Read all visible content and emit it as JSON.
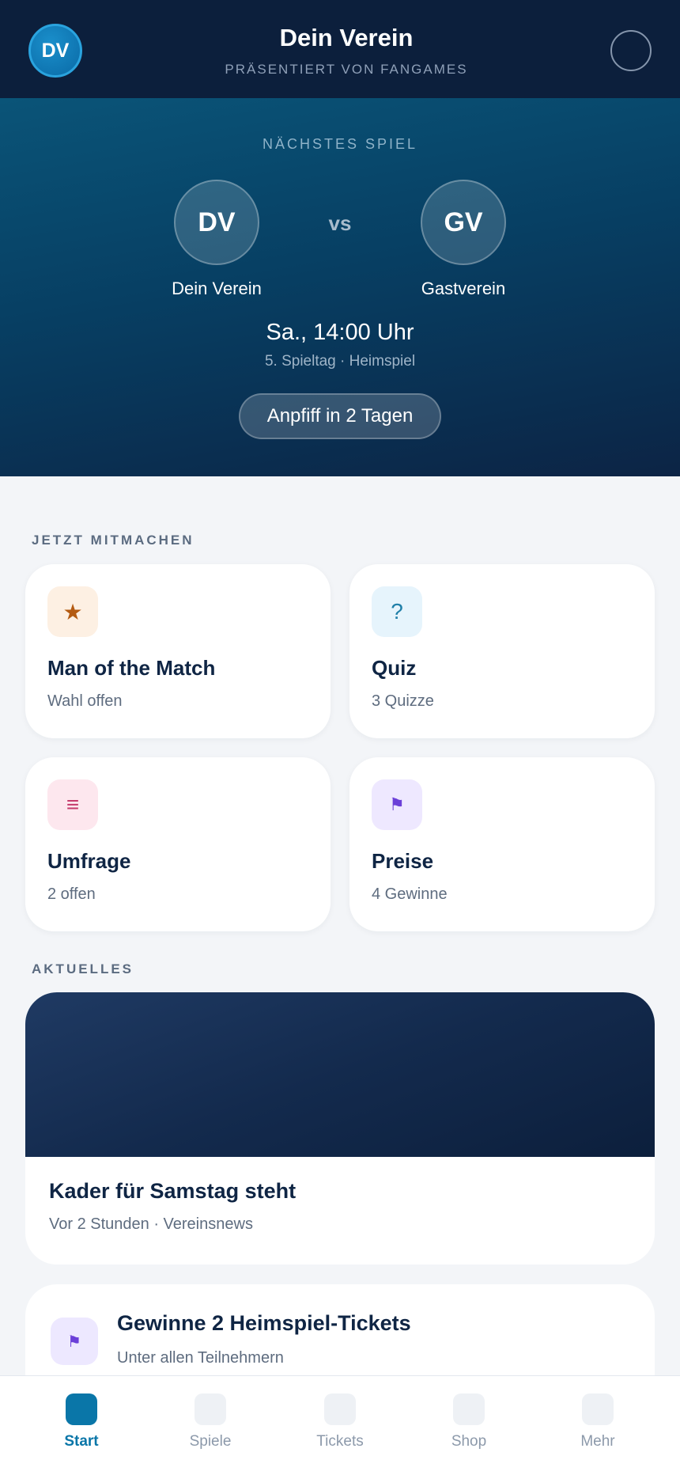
{
  "header": {
    "logo_text": "DV",
    "title": "Dein Verein",
    "subtitle": "PRÄSENTIERT VON FANGAMES"
  },
  "next_match": {
    "label": "NÄCHSTES SPIEL",
    "home": {
      "crest": "DV",
      "name": "Dein Verein"
    },
    "vs": "vs",
    "away": {
      "crest": "GV",
      "name": "Gastverein"
    },
    "kickoff": "Sa., 14:00 Uhr",
    "round": "5. Spieltag · Heimspiel",
    "countdown": "Anpfiff in 2 Tagen"
  },
  "participate": {
    "label": "JETZT MITMACHEN",
    "cards": [
      {
        "icon": "★",
        "icon_name": "star-icon",
        "title": "Man of the Match",
        "sub": "Wahl offen",
        "icon_bg": "#fdf0e3",
        "icon_color": "#b45b12"
      },
      {
        "icon": "?",
        "icon_name": "question-icon",
        "title": "Quiz",
        "sub": "3 Quizze",
        "icon_bg": "#e6f4fc",
        "icon_color": "#1f7fa8"
      },
      {
        "icon": "≡",
        "icon_name": "list-icon",
        "title": "Umfrage",
        "sub": "2 offen",
        "icon_bg": "#fde7ee",
        "icon_color": "#c53b6c"
      },
      {
        "icon": "⚑",
        "icon_name": "flag-icon",
        "title": "Preise",
        "sub": "4 Gewinne",
        "icon_bg": "#eee8ff",
        "icon_color": "#6b3fd8"
      }
    ]
  },
  "news": {
    "label": "AKTUELLES",
    "title": "Kader für Samstag steht",
    "sub": "Vor 2 Stunden · Vereinsnews"
  },
  "promo": {
    "icon": "⚑",
    "title": "Gewinne 2 Heimspiel-Tickets",
    "sub": "Unter allen Teilnehmern"
  },
  "nav": {
    "items": [
      {
        "label": "Start",
        "active": true
      },
      {
        "label": "Spiele",
        "active": false
      },
      {
        "label": "Tickets",
        "active": false
      },
      {
        "label": "Shop",
        "active": false
      },
      {
        "label": "Mehr",
        "active": false
      }
    ]
  },
  "colors": {
    "accent": "#0a76a8",
    "header_bg": "#0c1f3c"
  }
}
